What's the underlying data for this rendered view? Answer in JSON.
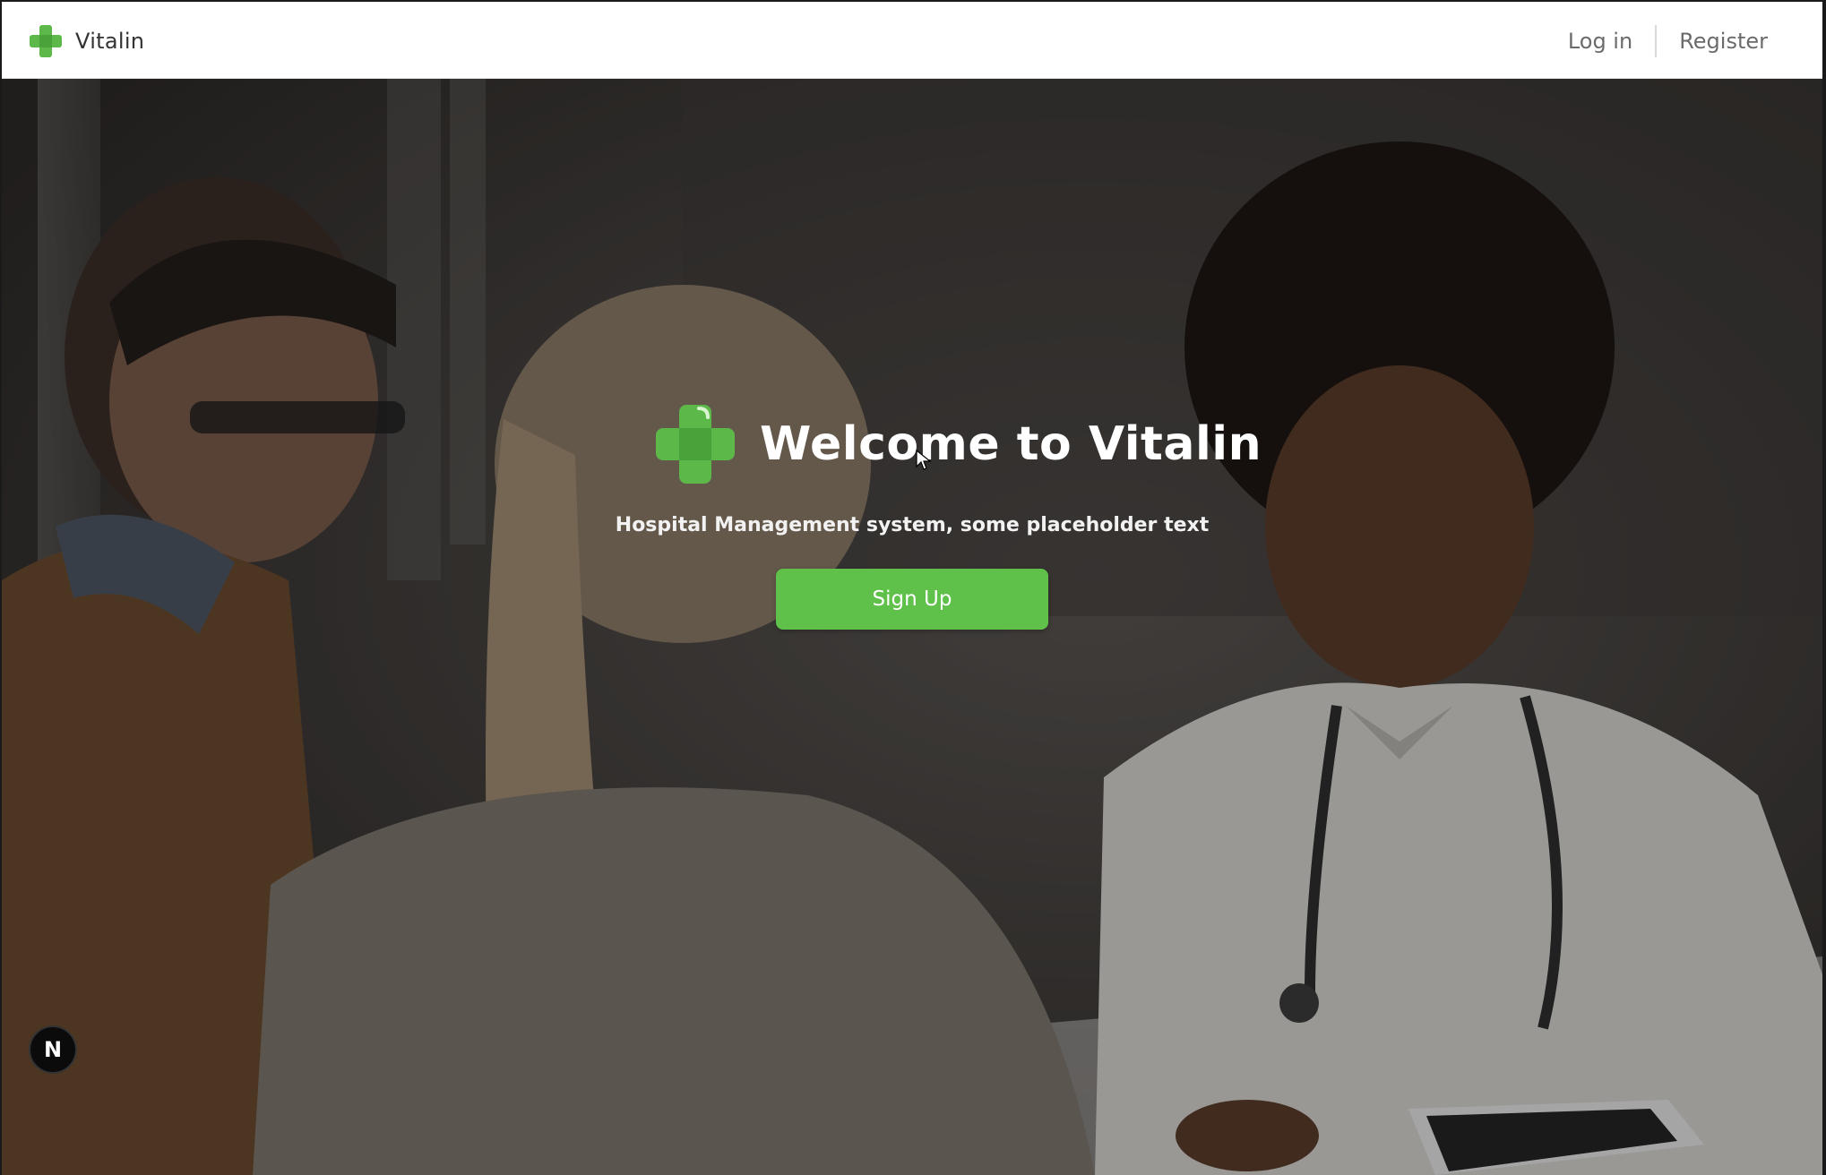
{
  "header": {
    "brand_name": "Vitalin",
    "brand_icon": "green-cross-icon",
    "nav": {
      "login_label": "Log in",
      "register_label": "Register"
    }
  },
  "hero": {
    "title": "Welcome to Vitalin",
    "subtitle": "Hospital Management system, some placeholder text",
    "cta_label": "Sign Up",
    "background": "hero-photo-doctor-consultation"
  },
  "dev_badge": {
    "label": "N"
  },
  "colors": {
    "brand_green": "#5fc14a",
    "nav_text": "#6b6b6b",
    "title_text": "#ffffff"
  }
}
